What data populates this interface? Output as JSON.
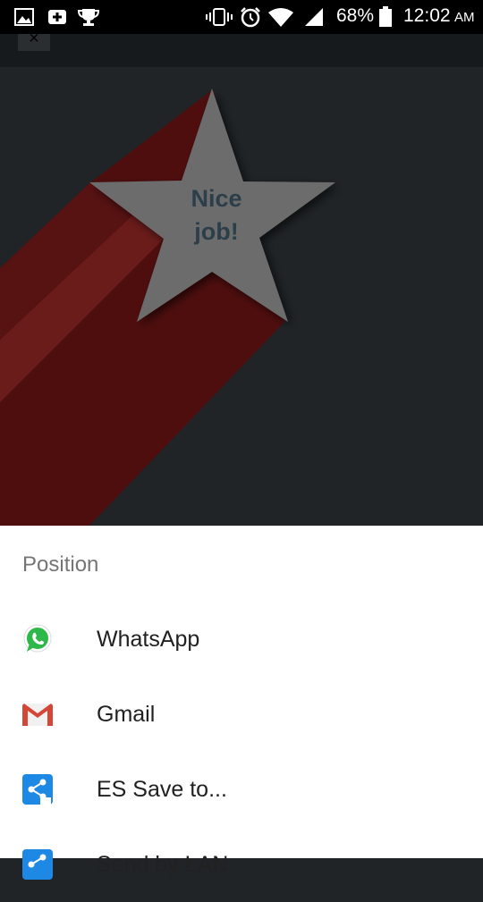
{
  "status_bar": {
    "icons_left": [
      "gallery-icon",
      "add-icon",
      "trophy-icon"
    ],
    "icons_right": [
      "vibrate-icon",
      "alarm-icon",
      "wifi-icon",
      "signal-icon"
    ],
    "battery": "68%",
    "time": "12:02",
    "ampm": "AM"
  },
  "toolbar": {
    "close_glyph": "×"
  },
  "hero": {
    "star_line1": "Nice",
    "star_line2": "job!",
    "colors": {
      "background": "#202427",
      "stripe": "#5a1010",
      "star": "#6a6a6a"
    }
  },
  "share_sheet": {
    "title": "Position",
    "items": [
      {
        "label": "WhatsApp",
        "icon": "whatsapp-icon"
      },
      {
        "label": "Gmail",
        "icon": "gmail-icon"
      },
      {
        "label": "ES Save to...",
        "icon": "es-save-icon"
      },
      {
        "label": "Send by LAN",
        "icon": "es-lan-icon"
      }
    ]
  }
}
